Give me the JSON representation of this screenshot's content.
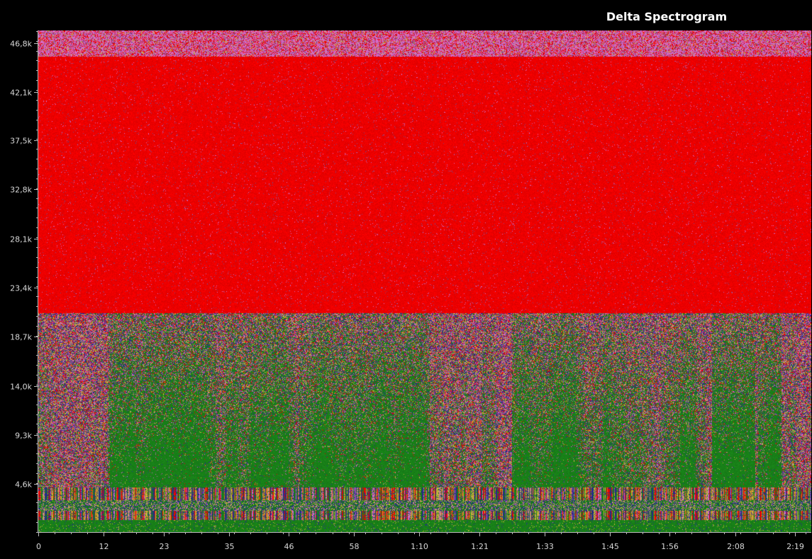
{
  "chart_data": {
    "type": "heatmap",
    "title": "Delta Spectrogram",
    "xlabel": "",
    "ylabel": "",
    "x_ticks": [
      "0",
      "12",
      "23",
      "35",
      "46",
      "58",
      "1:10",
      "1:21",
      "1:33",
      "1:45",
      "1:56",
      "2:08",
      "2:19"
    ],
    "x_tick_seconds": [
      0,
      12,
      23,
      35,
      46,
      58,
      70,
      81,
      93,
      105,
      116,
      128,
      139
    ],
    "xlim": [
      0,
      142
    ],
    "y_ticks": [
      "4,6k",
      "9,3k",
      "14,0k",
      "18,7k",
      "23,4k",
      "28,1k",
      "32,8k",
      "37,5k",
      "42,1k",
      "46,8k"
    ],
    "y_tick_hz": [
      4600,
      9300,
      14000,
      18700,
      23400,
      28100,
      32800,
      37500,
      42100,
      46800
    ],
    "ylim": [
      0,
      48000
    ],
    "bands": [
      {
        "from_hz": 45500,
        "to_hz": 48000,
        "dominant": "#e070d0"
      },
      {
        "from_hz": 21000,
        "to_hz": 45500,
        "dominant": "#ff0000"
      },
      {
        "from_hz": 4300,
        "to_hz": 21000,
        "dominant": "mixed"
      },
      {
        "from_hz": 3100,
        "to_hz": 4300,
        "dominant": "striped"
      },
      {
        "from_hz": 2100,
        "to_hz": 3100,
        "dominant": "mixed"
      },
      {
        "from_hz": 1200,
        "to_hz": 2100,
        "dominant": "striped"
      },
      {
        "from_hz": 0,
        "to_hz": 1200,
        "dominant": "#1a8a1a"
      }
    ],
    "palette": [
      "#ff0000",
      "#1a8a1a",
      "#2a2a9a",
      "#d4c040",
      "#e070d0",
      "#8a4a8a"
    ],
    "grid": false,
    "legend": "none"
  }
}
